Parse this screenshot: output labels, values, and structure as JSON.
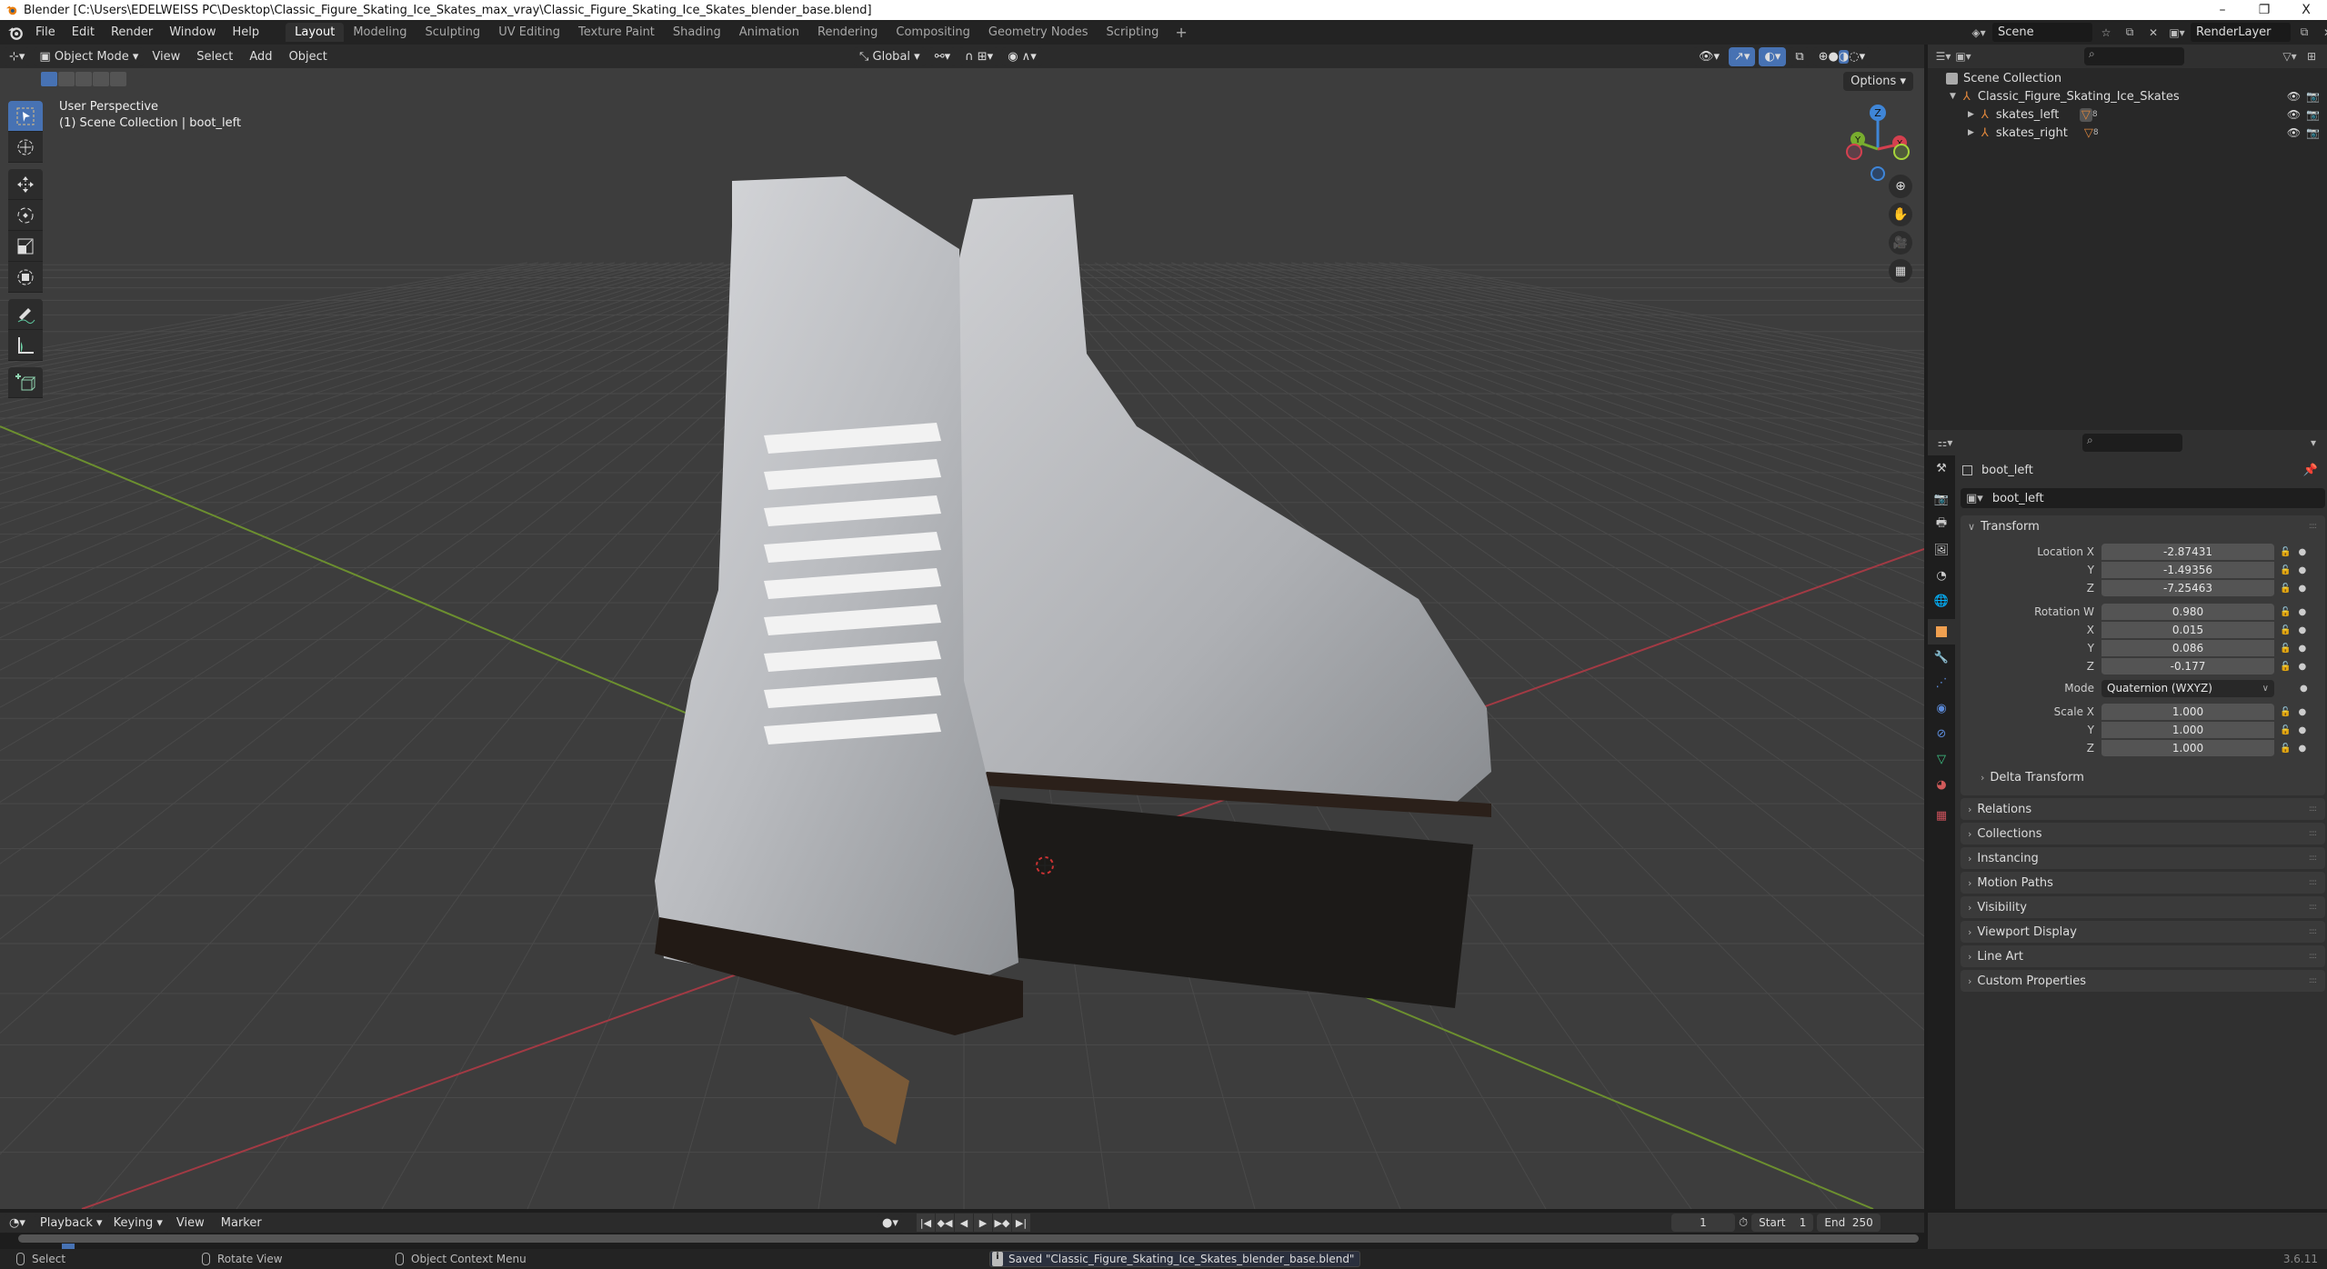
{
  "window": {
    "title": "Blender [C:\\Users\\EDELWEISS PC\\Desktop\\Classic_Figure_Skating_Ice_Skates_max_vray\\Classic_Figure_Skating_Ice_Skates_blender_base.blend]",
    "controls": {
      "minimize": "–",
      "restore": "❐",
      "close": "X"
    }
  },
  "menubar": {
    "items": [
      "File",
      "Edit",
      "Render",
      "Window",
      "Help"
    ],
    "workspaces": [
      "Layout",
      "Modeling",
      "Sculpting",
      "UV Editing",
      "Texture Paint",
      "Shading",
      "Animation",
      "Rendering",
      "Compositing",
      "Geometry Nodes",
      "Scripting"
    ],
    "active_workspace": "Layout",
    "add_workspace": "+",
    "scene": "Scene",
    "view_layer": "RenderLayer"
  },
  "viewport": {
    "mode": "Object Mode",
    "menus": [
      "View",
      "Select",
      "Add",
      "Object"
    ],
    "transform_orientation": "Global",
    "options_label": "Options",
    "info_line1": "User Perspective",
    "info_line2": "(1) Scene Collection | boot_left",
    "gizmo_axes": {
      "x": "X",
      "y": "Y",
      "z": "Z"
    },
    "tools": [
      "select-box",
      "cursor",
      "move",
      "rotate",
      "scale",
      "transform",
      "annotate",
      "measure",
      "add-cube"
    ],
    "shading_mode": "material-preview",
    "colors": {
      "background": "#3d3d3d",
      "grid": "#4a4a4a",
      "x_axis": "#b0434a",
      "y_axis": "#7da33a",
      "accent": "#4772b3"
    }
  },
  "outliner": {
    "root": "Scene Collection",
    "items": [
      {
        "name": "Classic_Figure_Skating_Ice_Skates",
        "level": 1,
        "expanded": true
      },
      {
        "name": "skates_left",
        "level": 2,
        "expanded": false,
        "modifier_count": "8"
      },
      {
        "name": "skates_right",
        "level": 2,
        "expanded": false,
        "modifier_count": "8"
      }
    ]
  },
  "properties": {
    "object_name": "boot_left",
    "data_name": "boot_left",
    "transform_title": "Transform",
    "location": {
      "label": "Location X",
      "x": "-2.87431",
      "y": "-1.49356",
      "z": "-7.25463"
    },
    "rotation": {
      "label": "Rotation W",
      "w": "0.980",
      "x": "0.015",
      "y": "0.086",
      "z": "-0.177"
    },
    "mode_label": "Mode",
    "mode_value": "Quaternion (WXYZ)",
    "scale": {
      "label": "Scale X",
      "x": "1.000",
      "y": "1.000",
      "z": "1.000"
    },
    "axis_labels": {
      "x": "X",
      "y": "Y",
      "z": "Z"
    },
    "delta_transform": "Delta Transform",
    "panels": [
      "Relations",
      "Collections",
      "Instancing",
      "Motion Paths",
      "Visibility",
      "Viewport Display",
      "Line Art",
      "Custom Properties"
    ]
  },
  "timeline": {
    "menus": [
      "Playback",
      "Keying",
      "View",
      "Marker"
    ],
    "current_frame": "1",
    "start_label": "Start",
    "start": "1",
    "end_label": "End",
    "end": "250"
  },
  "statusbar": {
    "select": "Select",
    "rotate": "Rotate View",
    "context": "Object Context Menu",
    "message": "Saved \"Classic_Figure_Skating_Ice_Skates_blender_base.blend\"",
    "version": "3.6.11"
  }
}
